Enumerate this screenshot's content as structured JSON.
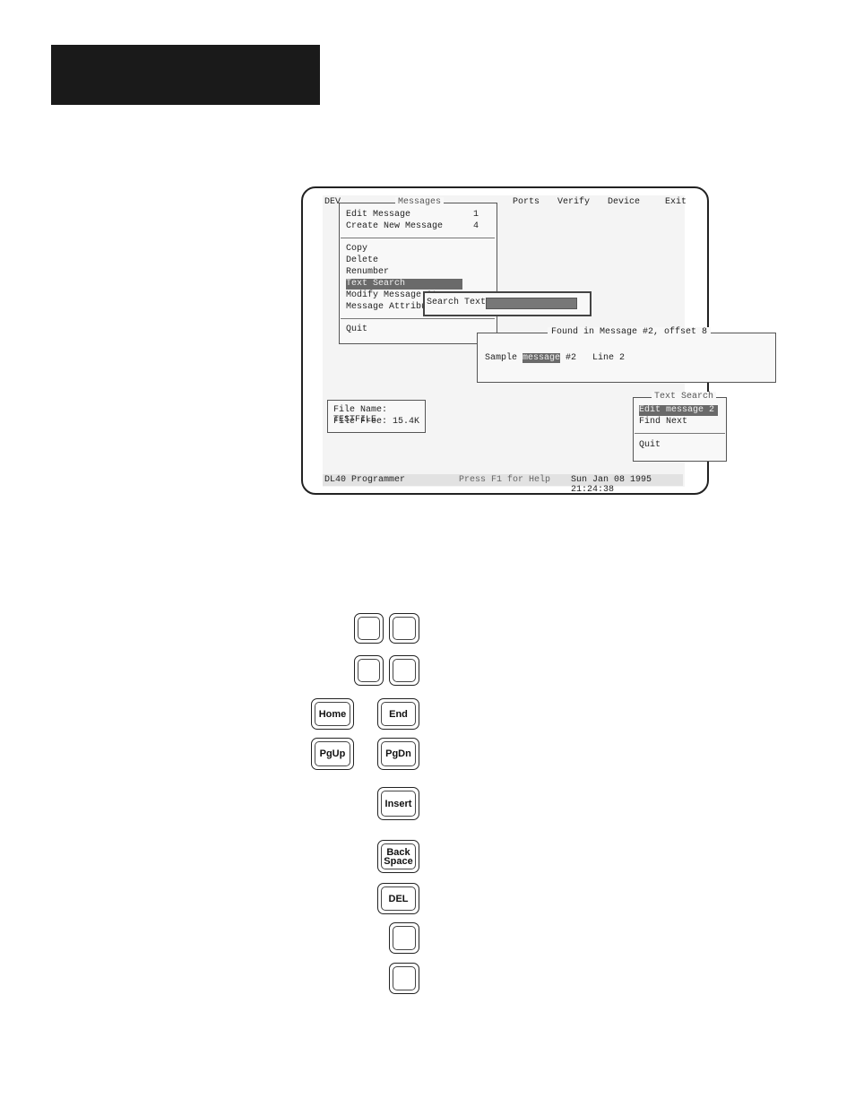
{
  "menubar": {
    "items": [
      "DEV",
      "Ports",
      "Verify",
      "Device",
      "Exit"
    ]
  },
  "messages_menu": {
    "title": "Messages",
    "items": [
      {
        "label": "Edit Message",
        "num": "1"
      },
      {
        "label": "Create New Message",
        "num": "4"
      },
      {
        "label": "Copy"
      },
      {
        "label": "Delete"
      },
      {
        "label": "Renumber"
      },
      {
        "label": "Text Search"
      },
      {
        "label": "Modify Message At"
      },
      {
        "label": "Message Attribute"
      },
      {
        "label": "Quit"
      }
    ],
    "selected": "Text Search"
  },
  "search_dialog": {
    "label": "Search Text:",
    "value": ""
  },
  "found_panel": {
    "title": "Found in Message #2, offset 8",
    "line_prefix": "Sample ",
    "line_match": "message",
    "line_suffix": " #2   Line 2"
  },
  "file_info": {
    "name_line": "File Name: TESTFILE",
    "free_line": "File Free:  15.4K"
  },
  "text_search_menu": {
    "title": "Text Search",
    "items": [
      "Edit message 2",
      "Find Next",
      "Quit"
    ],
    "selected": "Edit message 2"
  },
  "statusbar": {
    "app": "DL40 Programmer",
    "help": "Press F1 for Help",
    "datetime": "Sun Jan 08 1995 21:24:38"
  },
  "keys": {
    "home": "Home",
    "end": "End",
    "pgup": "PgUp",
    "pgdn": "PgDn",
    "insert": "Insert",
    "backspace_line1": "Back",
    "backspace_line2": "Space",
    "del": "DEL"
  }
}
